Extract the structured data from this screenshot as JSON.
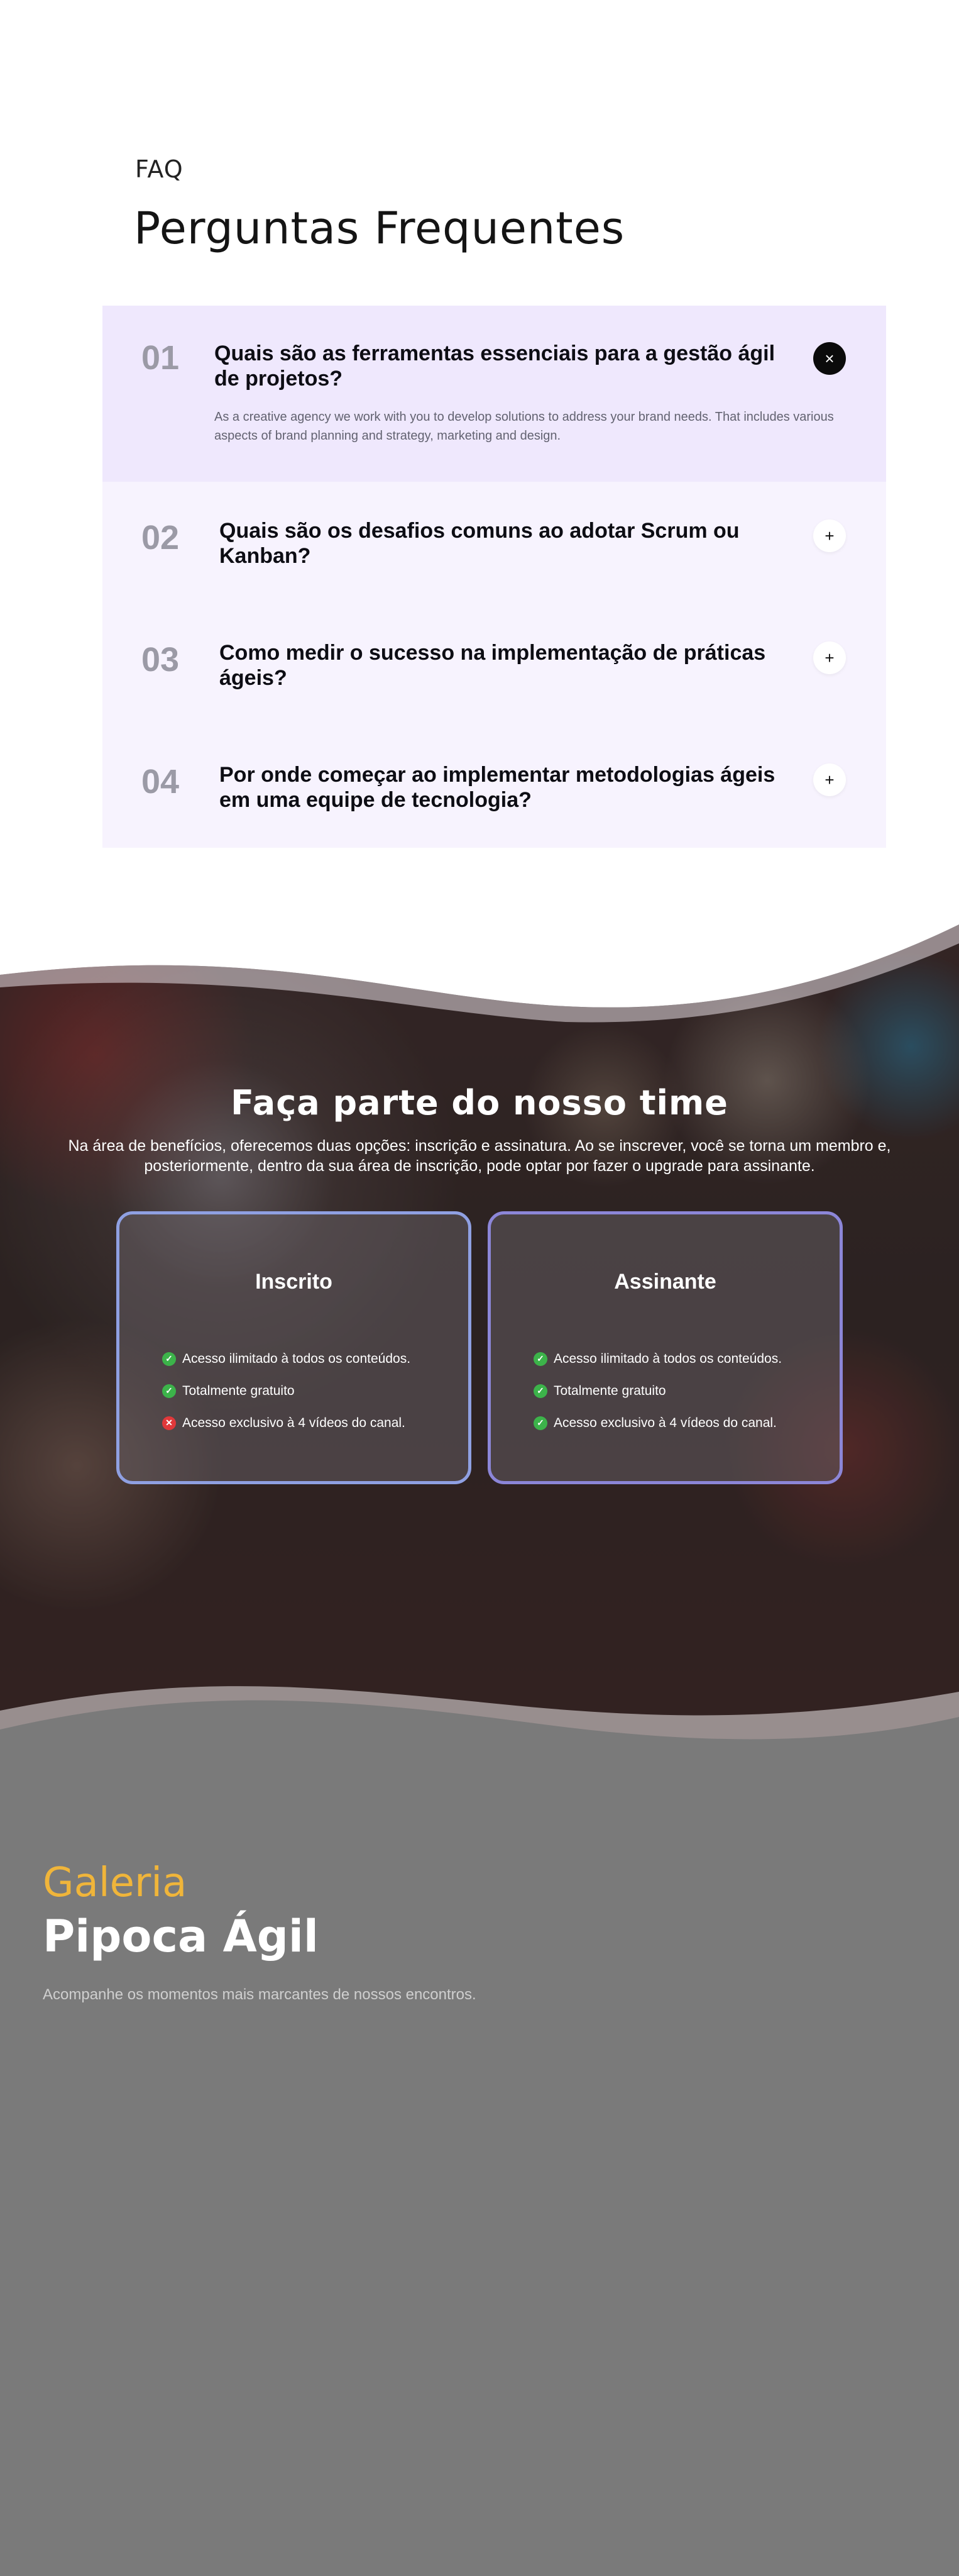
{
  "faq": {
    "eyebrow": "FAQ",
    "title": "Perguntas Frequentes",
    "items": [
      {
        "number": "01",
        "question": "Quais são as ferramentas essenciais para a gestão ágil de projetos?",
        "answer": "As a creative agency we work with you to develop solutions to address your brand needs. That includes various aspects of brand planning and strategy, marketing and design.",
        "toggle": "×"
      },
      {
        "number": "02",
        "question": "Quais são os desafios comuns ao adotar Scrum ou Kanban?",
        "toggle": "+"
      },
      {
        "number": "03",
        "question": "Como medir o sucesso na implementação de práticas ágeis?",
        "toggle": "+"
      },
      {
        "number": "04",
        "question": "Por onde começar ao implementar metodologias ágeis em uma equipe de tecnologia?",
        "toggle": "+"
      }
    ]
  },
  "team": {
    "title": "Faça parte do nosso time",
    "description": "Na área de benefícios, oferecemos duas opções: inscrição e assinatura. Ao se inscrever, você se torna um membro e, posteriormente, dentro da sua área de inscrição, pode optar por fazer o upgrade para assinante.",
    "plans": [
      {
        "title": "Inscrito",
        "features": [
          {
            "text": "Acesso ilimitado à todos os conteúdos.",
            "included": true,
            "icon": "✓"
          },
          {
            "text": "Totalmente gratuito",
            "included": true,
            "icon": "✓"
          },
          {
            "text": "Acesso exclusivo à 4 vídeos do canal.",
            "included": false,
            "icon": "✕"
          }
        ]
      },
      {
        "title": "Assinante",
        "features": [
          {
            "text": "Acesso ilimitado à todos os conteúdos.",
            "included": true,
            "icon": "✓"
          },
          {
            "text": "Totalmente gratuito",
            "included": true,
            "icon": "✓"
          },
          {
            "text": "Acesso exclusivo à 4 vídeos do canal.",
            "included": true,
            "icon": "✓"
          }
        ]
      }
    ]
  },
  "gallery": {
    "eyebrow": "Galeria",
    "title": "Pipoca Ágil",
    "subtitle": "Acompanhe os momentos mais marcantes de nossos encontros."
  },
  "colors": {
    "accent_yellow": "#f0b53a",
    "faq_open_bg": "#efe8fd",
    "faq_bg": "#f7f3fe",
    "check_green": "#3cb34a",
    "cross_red": "#e0383a",
    "gallery_bg": "#7a7a7a"
  }
}
